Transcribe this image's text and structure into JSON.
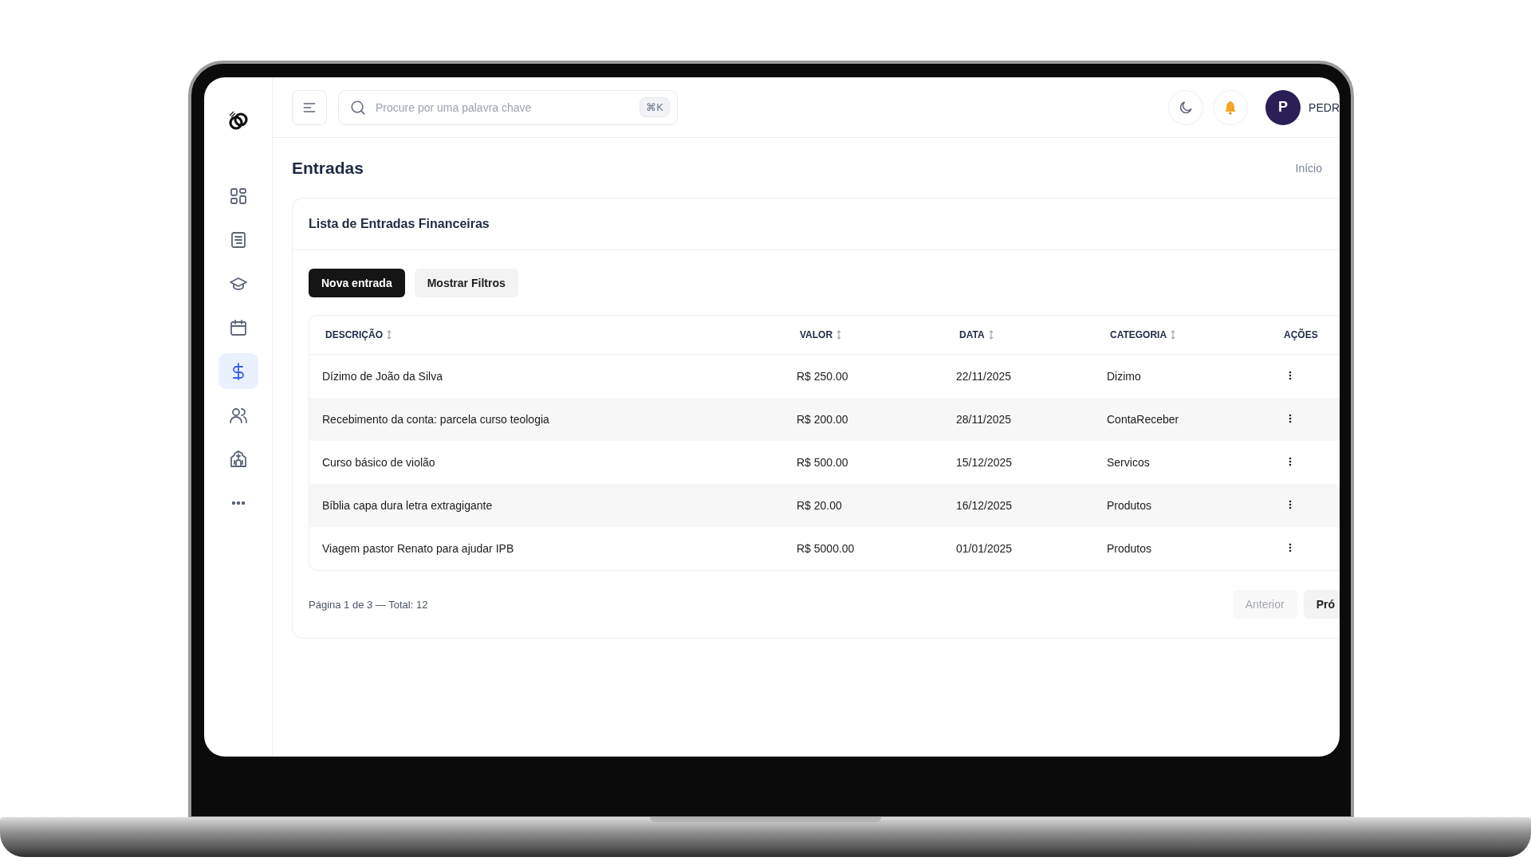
{
  "sidebar": {
    "items": [
      {
        "selected": false
      },
      {
        "selected": false
      },
      {
        "selected": false
      },
      {
        "selected": false
      },
      {
        "selected": true
      },
      {
        "selected": false
      },
      {
        "selected": false
      },
      {
        "selected": false
      }
    ]
  },
  "header": {
    "search": {
      "placeholder": "Procure por uma palavra chave",
      "shortcut": "⌘K"
    },
    "user": {
      "initial": "P",
      "name": "PEDR"
    }
  },
  "page": {
    "title": "Entradas",
    "breadcrumb": "Início"
  },
  "card": {
    "title": "Lista de Entradas Financeiras",
    "buttons": [
      {
        "label": "Nova entrada",
        "kind": "primary"
      },
      {
        "label": "Mostrar Filtros",
        "kind": "secondary"
      }
    ],
    "table": {
      "columns": [
        {
          "label": "DESCRIÇÃO",
          "sortable": true
        },
        {
          "label": "VALOR",
          "sortable": true
        },
        {
          "label": "DATA",
          "sortable": true
        },
        {
          "label": "CATEGORIA",
          "sortable": true
        },
        {
          "label": "AÇÕES",
          "sortable": false
        }
      ],
      "rows": [
        {
          "cells": [
            "Dízimo de João da Silva",
            "R$ 250.00",
            "22/11/2025",
            "Dizimo"
          ]
        },
        {
          "cells": [
            "Recebimento da conta: parcela curso teologia",
            "R$ 200.00",
            "28/11/2025",
            "ContaReceber"
          ]
        },
        {
          "cells": [
            "Curso básico de violão",
            "R$ 500.00",
            "15/12/2025",
            "Servicos"
          ]
        },
        {
          "cells": [
            "Bíblia capa dura letra extragigante",
            "R$ 20.00",
            "16/12/2025",
            "Produtos"
          ]
        },
        {
          "cells": [
            "Viagem pastor Renato para ajudar IPB",
            "R$ 5000.00",
            "01/01/2025",
            "Produtos"
          ]
        }
      ]
    },
    "pagination": {
      "summary": "Página 1 de 3 — Total: 12",
      "buttons": [
        {
          "label": "Anterior",
          "disabled": true
        },
        {
          "label": "Pró",
          "disabled": false
        }
      ]
    }
  }
}
